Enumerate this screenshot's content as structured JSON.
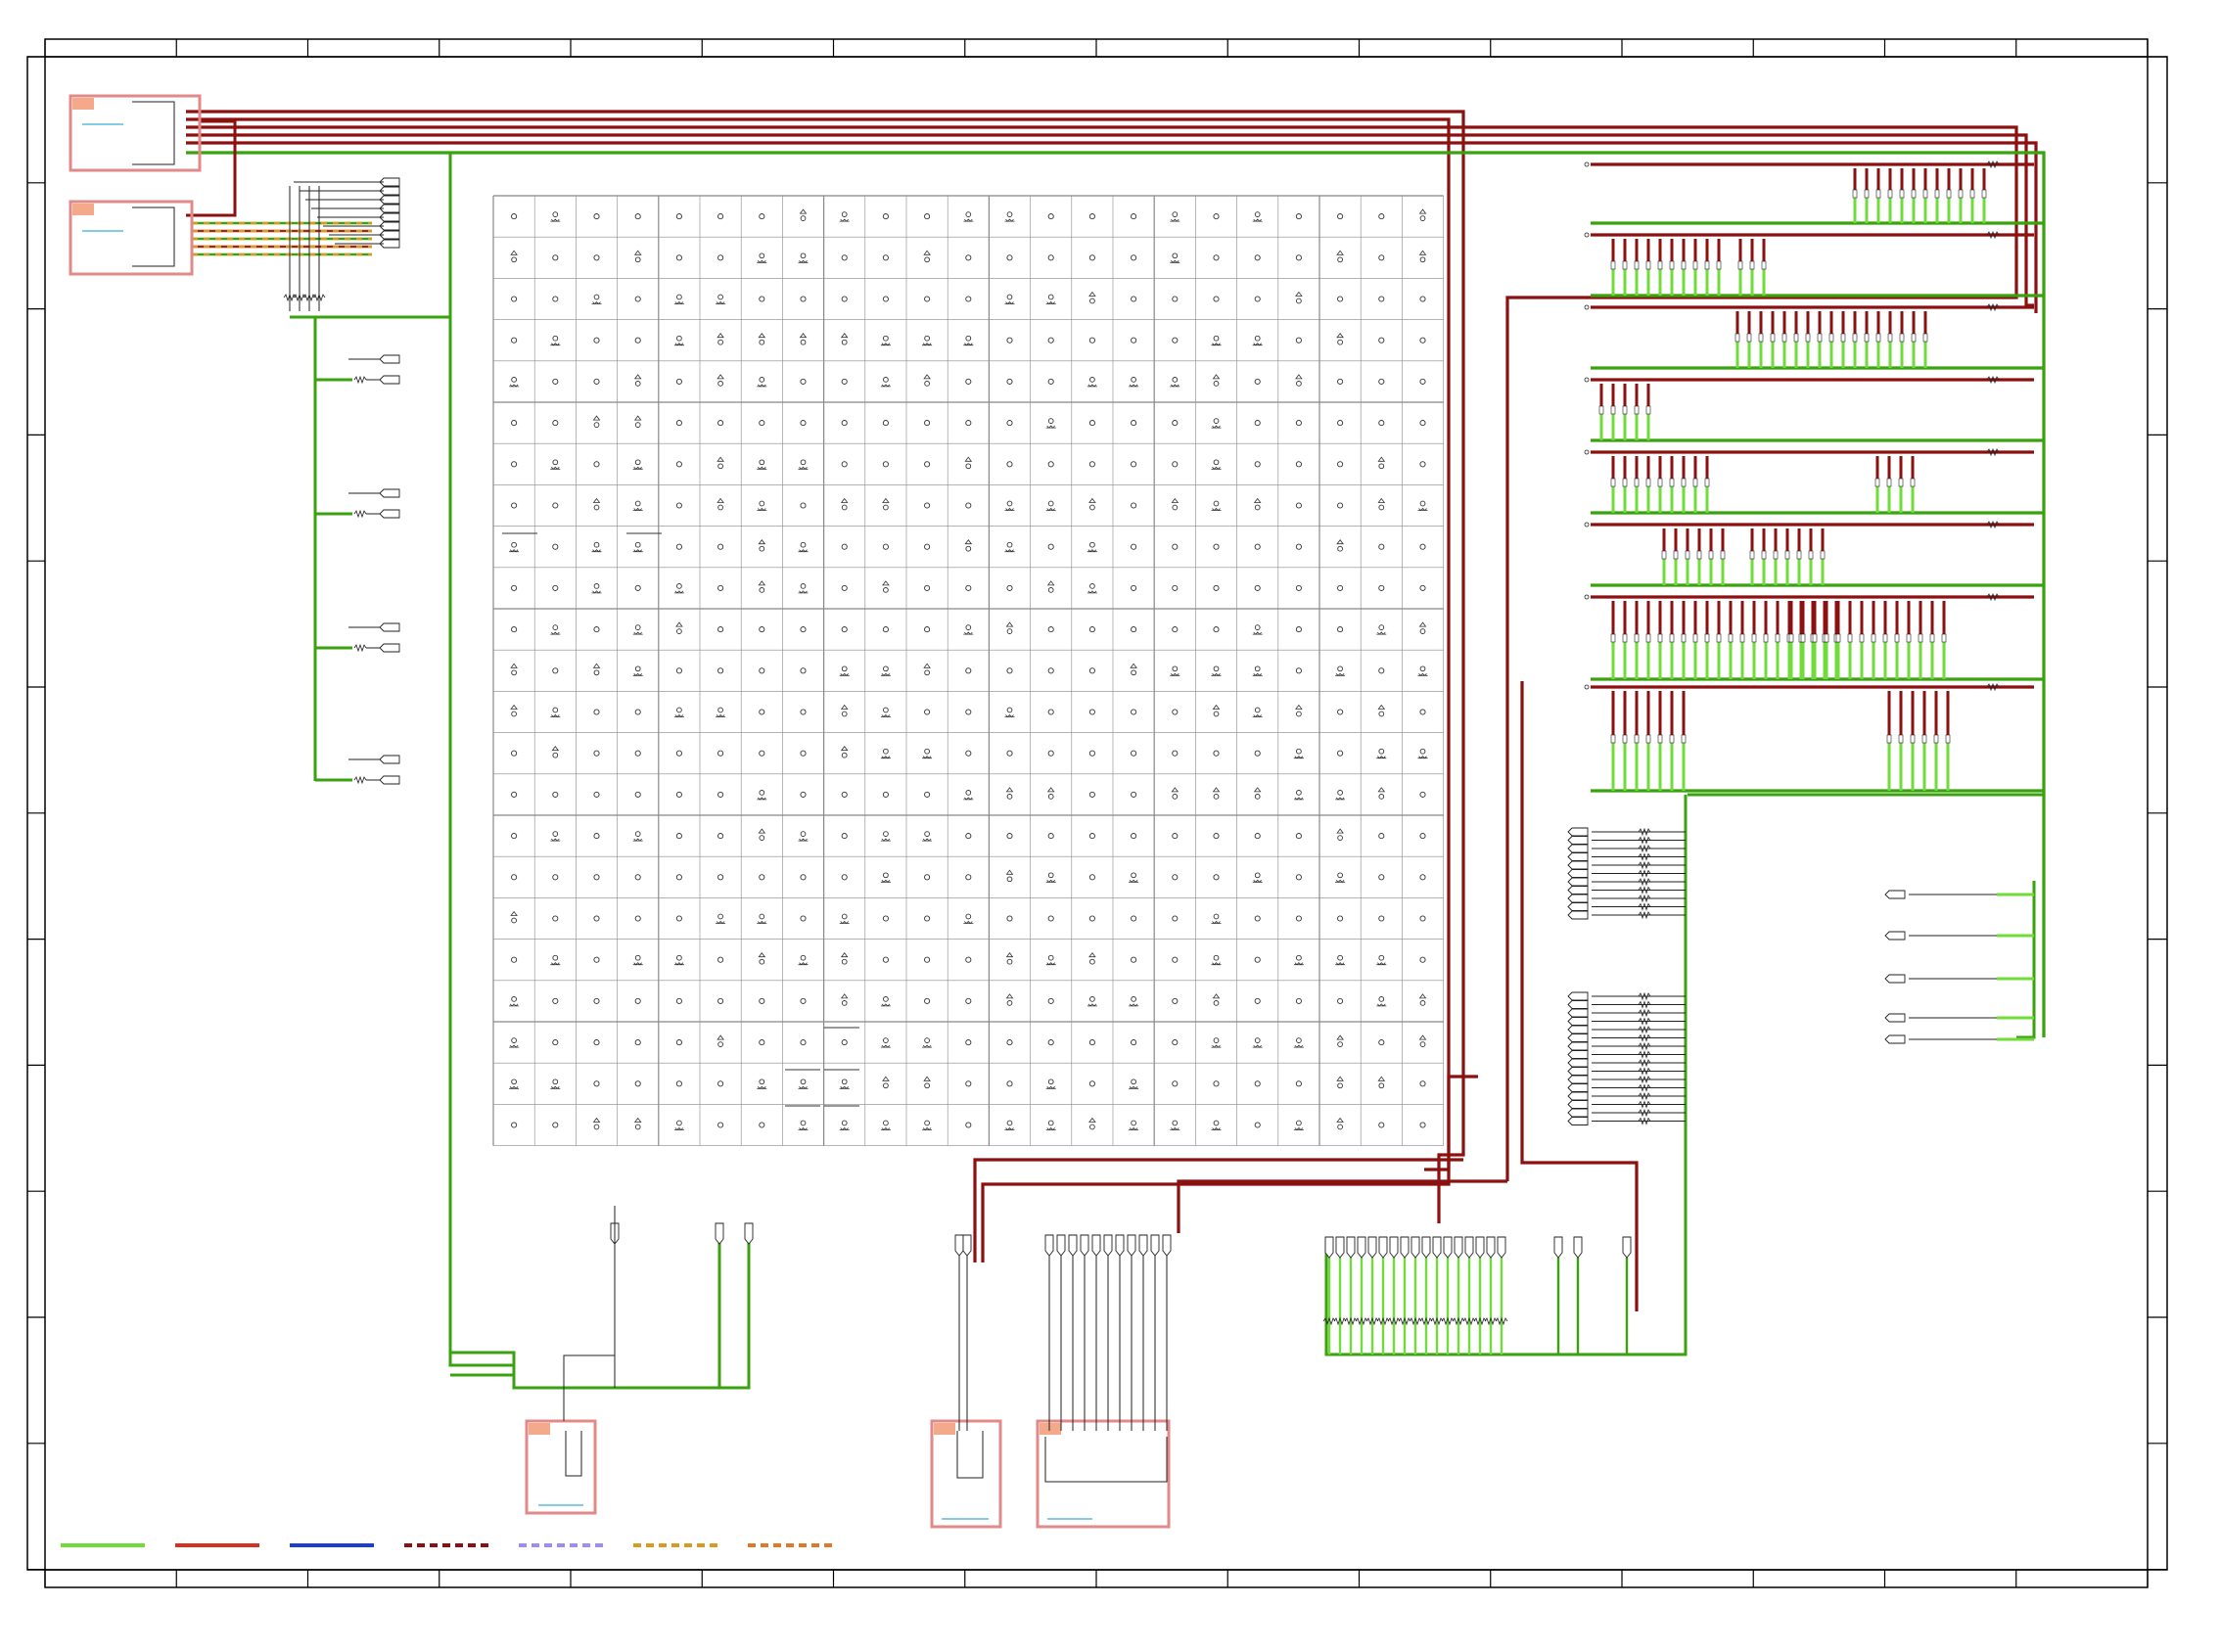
{
  "diagram": {
    "type": "electrical-wiring-schematic",
    "title": "",
    "grid": {
      "rows": 23,
      "cols": 23,
      "label": ""
    },
    "wire_colors": {
      "green": "#3aa10f",
      "green_bright": "#6fdc3a",
      "dark_red": "#8b1010",
      "red": "#d4321e",
      "blue": "#1a3fcf",
      "connector_border": "#e08a8a",
      "connector_fill": "#f4a98a",
      "accent_cyan": "#3aaed8"
    },
    "legend": [
      {
        "style": "solid",
        "color": "#6fdc3a",
        "label": ""
      },
      {
        "style": "solid",
        "color": "#d4321e",
        "label": ""
      },
      {
        "style": "solid",
        "color": "#1a3fcf",
        "label": ""
      },
      {
        "style": "dashed",
        "color": "#8b1010",
        "label": ""
      },
      {
        "style": "dashed",
        "color": "#9a8ef0",
        "label": ""
      },
      {
        "style": "dashed",
        "color": "#d89a20",
        "label": ""
      },
      {
        "style": "dashed",
        "color": "#e0782a",
        "label": ""
      }
    ],
    "connectors": [
      {
        "id": "conn-top-left-1",
        "label": ""
      },
      {
        "id": "conn-top-left-2",
        "label": ""
      },
      {
        "id": "conn-bottom-1",
        "label": ""
      },
      {
        "id": "conn-bottom-2",
        "label": ""
      },
      {
        "id": "conn-bottom-3",
        "label": ""
      }
    ],
    "icons": {
      "connector": "connector-block-icon",
      "terminal": "terminal-pin-icon",
      "resistor": "resistor-icon",
      "ground": "ground-icon"
    }
  }
}
